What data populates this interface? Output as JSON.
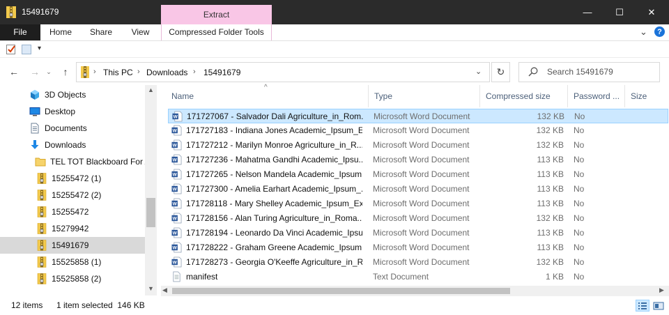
{
  "window": {
    "title": "15491679",
    "contextual_tab_group": "Extract",
    "minimize_glyph": "—",
    "maximize_glyph": "☐",
    "close_glyph": "✕"
  },
  "ribbon": {
    "tabs": [
      "File",
      "Home",
      "Share",
      "View",
      "Compressed Folder Tools"
    ],
    "help_glyph": "?",
    "collapse_glyph": "⌄"
  },
  "quick_access": {
    "customize_glyph": "▾"
  },
  "address": {
    "breadcrumbs": [
      "This PC",
      "Downloads",
      "15491679"
    ],
    "separator": "›",
    "dropdown_glyph": "⌄",
    "back_glyph": "←",
    "forward_glyph": "→",
    "recent_glyph": "⌄",
    "up_glyph": "↑",
    "refresh_glyph": "↻"
  },
  "search": {
    "placeholder": "Search 15491679"
  },
  "nav_pane": {
    "items": [
      {
        "label": "3D Objects",
        "icon": "3d-objects-icon"
      },
      {
        "label": "Desktop",
        "icon": "desktop-icon"
      },
      {
        "label": "Documents",
        "icon": "documents-icon"
      },
      {
        "label": "Downloads",
        "icon": "downloads-icon"
      },
      {
        "label": "TEL TOT Blackboard For Ac",
        "icon": "folder-icon"
      },
      {
        "label": "15255472 (1)",
        "icon": "zip-folder-icon"
      },
      {
        "label": "15255472 (2)",
        "icon": "zip-folder-icon"
      },
      {
        "label": "15255472",
        "icon": "zip-folder-icon"
      },
      {
        "label": "15279942",
        "icon": "zip-folder-icon"
      },
      {
        "label": "15491679",
        "icon": "zip-folder-icon",
        "selected": true
      },
      {
        "label": "15525858 (1)",
        "icon": "zip-folder-icon"
      },
      {
        "label": "15525858 (2)",
        "icon": "zip-folder-icon"
      }
    ],
    "scroll_up_glyph": "▲",
    "scroll_down_glyph": "▼"
  },
  "file_list": {
    "columns": [
      "Name",
      "Type",
      "Compressed size",
      "Password ...",
      "Size"
    ],
    "sort_glyph": "^",
    "rows": [
      {
        "name": "171727067 - Salvador Dali Agriculture_in_Rom...",
        "type": "Microsoft Word Document",
        "compressed_size": "132 KB",
        "password": "No",
        "icon": "word-doc-icon",
        "selected": true
      },
      {
        "name": "171727183 - Indiana Jones Academic_Ipsum_E...",
        "type": "Microsoft Word Document",
        "compressed_size": "132 KB",
        "password": "No",
        "icon": "word-doc-icon"
      },
      {
        "name": "171727212 - Marilyn Monroe Agriculture_in_R...",
        "type": "Microsoft Word Document",
        "compressed_size": "132 KB",
        "password": "No",
        "icon": "word-doc-icon"
      },
      {
        "name": "171727236 - Mahatma Gandhi Academic_Ipsu...",
        "type": "Microsoft Word Document",
        "compressed_size": "113 KB",
        "password": "No",
        "icon": "word-doc-icon"
      },
      {
        "name": "171727265 - Nelson Mandela Academic_Ipsum...",
        "type": "Microsoft Word Document",
        "compressed_size": "113 KB",
        "password": "No",
        "icon": "word-doc-icon"
      },
      {
        "name": "171727300 - Amelia Earhart Academic_Ipsum_...",
        "type": "Microsoft Word Document",
        "compressed_size": "113 KB",
        "password": "No",
        "icon": "word-doc-icon"
      },
      {
        "name": "171728118 - Mary Shelley Academic_Ipsum_Ex...",
        "type": "Microsoft Word Document",
        "compressed_size": "113 KB",
        "password": "No",
        "icon": "word-doc-icon"
      },
      {
        "name": "171728156 - Alan Turing Agriculture_in_Roma...",
        "type": "Microsoft Word Document",
        "compressed_size": "132 KB",
        "password": "No",
        "icon": "word-doc-icon"
      },
      {
        "name": "171728194 - Leonardo Da Vinci Academic_Ipsu...",
        "type": "Microsoft Word Document",
        "compressed_size": "113 KB",
        "password": "No",
        "icon": "word-doc-icon"
      },
      {
        "name": "171728222 - Graham Greene Academic_Ipsum...",
        "type": "Microsoft Word Document",
        "compressed_size": "113 KB",
        "password": "No",
        "icon": "word-doc-icon"
      },
      {
        "name": "171728273 - Georgia O'Keeffe Agriculture_in_R...",
        "type": "Microsoft Word Document",
        "compressed_size": "132 KB",
        "password": "No",
        "icon": "word-doc-icon"
      },
      {
        "name": "manifest",
        "type": "Text Document",
        "compressed_size": "1 KB",
        "password": "No",
        "icon": "text-doc-icon"
      }
    ],
    "hscroll_left_glyph": "◀",
    "hscroll_right_glyph": "▶"
  },
  "status": {
    "item_count": "12 items",
    "selection": "1 item selected  146 KB"
  },
  "colors": {
    "titlebar": "#2b2b2b",
    "contextual_tab": "#f9c6e6",
    "selection_fill": "#cce8ff",
    "selection_border": "#99d1ff",
    "nav_selected": "#d9d9d9",
    "column_header_text": "#4c607a"
  }
}
